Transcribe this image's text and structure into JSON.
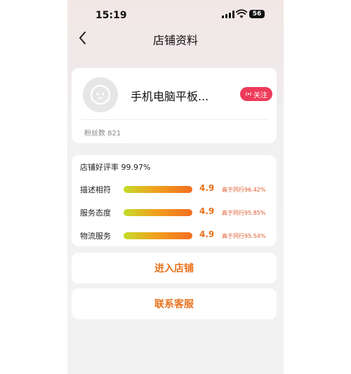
{
  "status_bar": {
    "time": "15:19",
    "battery": "56"
  },
  "nav": {
    "title": "店铺资料"
  },
  "shop": {
    "name": "手机电脑平板...",
    "follow_label": "关注",
    "fans": "粉丝数 821"
  },
  "ratings": {
    "overall": "店铺好评率 99.97%",
    "rows": [
      {
        "label": "描述相符",
        "score": "4.9",
        "compare": "高于同行96.42%",
        "level": 0.98
      },
      {
        "label": "服务态度",
        "score": "4.9",
        "compare": "高于同行95.85%",
        "level": 0.98
      },
      {
        "label": "物流服务",
        "score": "4.9",
        "compare": "高于同行95.54%",
        "level": 0.98
      }
    ]
  },
  "buttons": {
    "enter_shop": "进入店铺",
    "contact_service": "联系客服"
  },
  "colors": {
    "accent": "#e8721e",
    "follow": "#ee3b59"
  }
}
